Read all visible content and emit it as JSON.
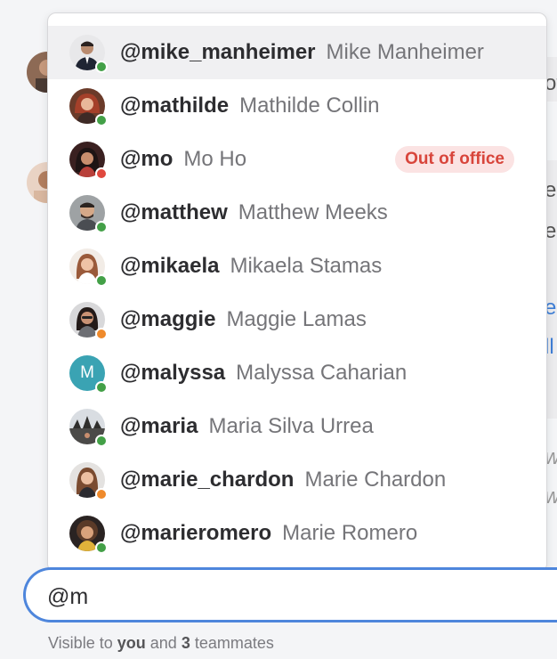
{
  "mention_query": "@m",
  "visibility": {
    "prefix": "Visible to",
    "you": "you",
    "and": "and",
    "count": "3",
    "suffix": "teammates"
  },
  "background_fragments": [
    "ot",
    "e",
    "e",
    "e",
    "ll"
  ],
  "suggestions": [
    {
      "handle": "@mike_manheimer",
      "name": "Mike Manheimer",
      "presence": "online",
      "selected": true,
      "avatar": "photo-man-dark-suit"
    },
    {
      "handle": "@mathilde",
      "name": "Mathilde Collin",
      "presence": "online",
      "avatar": "photo-woman-red-hair"
    },
    {
      "handle": "@mo",
      "name": "Mo Ho",
      "presence": "busy",
      "badge": "Out of office",
      "avatar": "photo-woman-dark-hair"
    },
    {
      "handle": "@matthew",
      "name": "Matthew Meeks",
      "presence": "online",
      "avatar": "photo-man-beard"
    },
    {
      "handle": "@mikaela",
      "name": "Mikaela Stamas",
      "presence": "online",
      "avatar": "photo-woman-smiling"
    },
    {
      "handle": "@maggie",
      "name": "Maggie Lamas",
      "presence": "away",
      "avatar": "photo-woman-glasses"
    },
    {
      "handle": "@malyssa",
      "name": "Malyssa Caharian",
      "presence": "online",
      "avatar": "initial-m",
      "initial": "M"
    },
    {
      "handle": "@maria",
      "name": "Maria Silva Urrea",
      "presence": "online",
      "avatar": "photo-landscape"
    },
    {
      "handle": "@marie_chardon",
      "name": "Marie Chardon",
      "presence": "away",
      "avatar": "photo-woman-long-hair"
    },
    {
      "handle": "@marieromero",
      "name": "Marie Romero",
      "presence": "online",
      "avatar": "photo-woman-curly-hair"
    }
  ],
  "colors": {
    "online": "#43a047",
    "busy": "#e0483e",
    "away": "#ef8a2b",
    "accent": "#4e86dc",
    "badge_bg": "#fbe3e3",
    "badge_text": "#d8453b"
  }
}
